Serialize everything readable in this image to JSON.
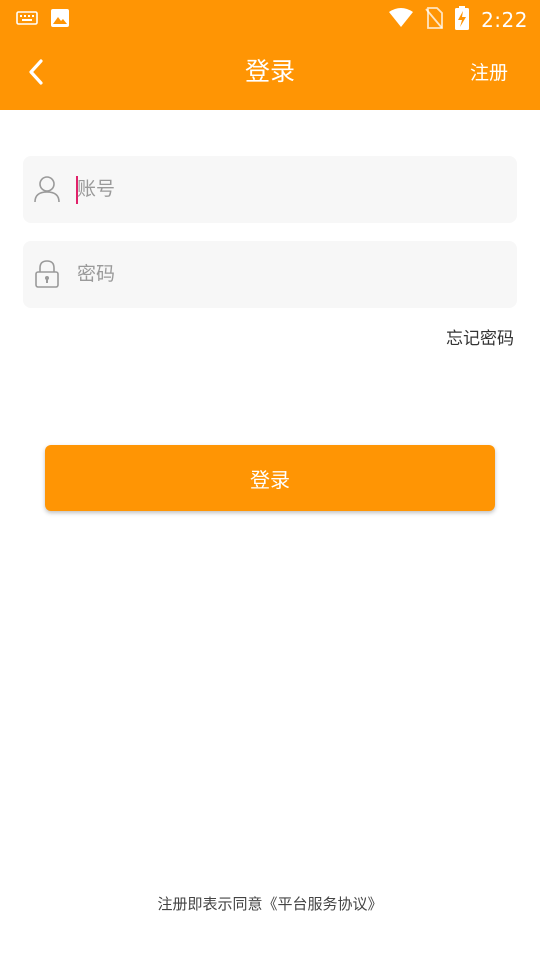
{
  "status_bar": {
    "time": "2:22",
    "icons": [
      "keyboard-icon",
      "image-icon",
      "wifi-icon",
      "no-sim-icon",
      "battery-charging-icon"
    ]
  },
  "app_bar": {
    "back_icon": "chevron-left-icon",
    "title": "登录",
    "register_label": "注册"
  },
  "form": {
    "account": {
      "icon": "user-icon",
      "placeholder": "账号"
    },
    "password": {
      "icon": "lock-icon",
      "placeholder": "密码"
    },
    "forgot_label": "忘记密码",
    "login_label": "登录"
  },
  "footer": {
    "agreement_text": "注册即表示同意《平台服务协议》"
  },
  "colors": {
    "brand": "#FF9504",
    "field_bg": "#F7F7F7",
    "cursor": "#E0226A"
  }
}
